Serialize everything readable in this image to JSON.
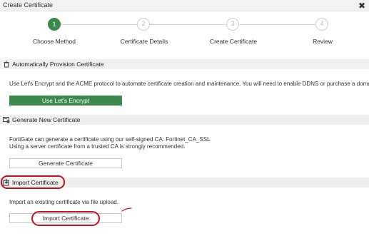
{
  "window": {
    "title": "Create Certificate",
    "close_glyph": "✖"
  },
  "stepper": {
    "steps": [
      {
        "number": "1",
        "label": "Choose Method",
        "state": "active"
      },
      {
        "number": "2",
        "label": "Certificate Details",
        "state": "inactive"
      },
      {
        "number": "3",
        "label": "Create Certificate",
        "state": "inactive"
      },
      {
        "number": "4",
        "label": "Review",
        "state": "inactive"
      }
    ]
  },
  "auto_provision": {
    "icon": "trash-can-icon",
    "title": "Automatically Provision Certificate",
    "description": "Use Let's Encrypt and the ACME protocol to automate certificate creation and maintenance. You will need to enable DDNS or purchase a domain.",
    "button_label": "Use Let's Encrypt"
  },
  "generate_new": {
    "icon": "certificate-add-icon",
    "title": "Generate New Certificate",
    "line1": "FortiGate can generate a certificate using our self-signed CA: Fortinet_CA_SSL",
    "line2": "Using a server certificate from a trusted CA is strongly recommended.",
    "button_label": "Generate Certificate"
  },
  "import": {
    "icon": "import-icon",
    "title": "Import Certificate",
    "description": "Import an existing certificate via file upload.",
    "button_label": "Import Certificate"
  },
  "colors": {
    "accent_green": "#3b8a4c",
    "annotation_red": "#c4121a",
    "section_header_bg": "#f0f0f0"
  }
}
